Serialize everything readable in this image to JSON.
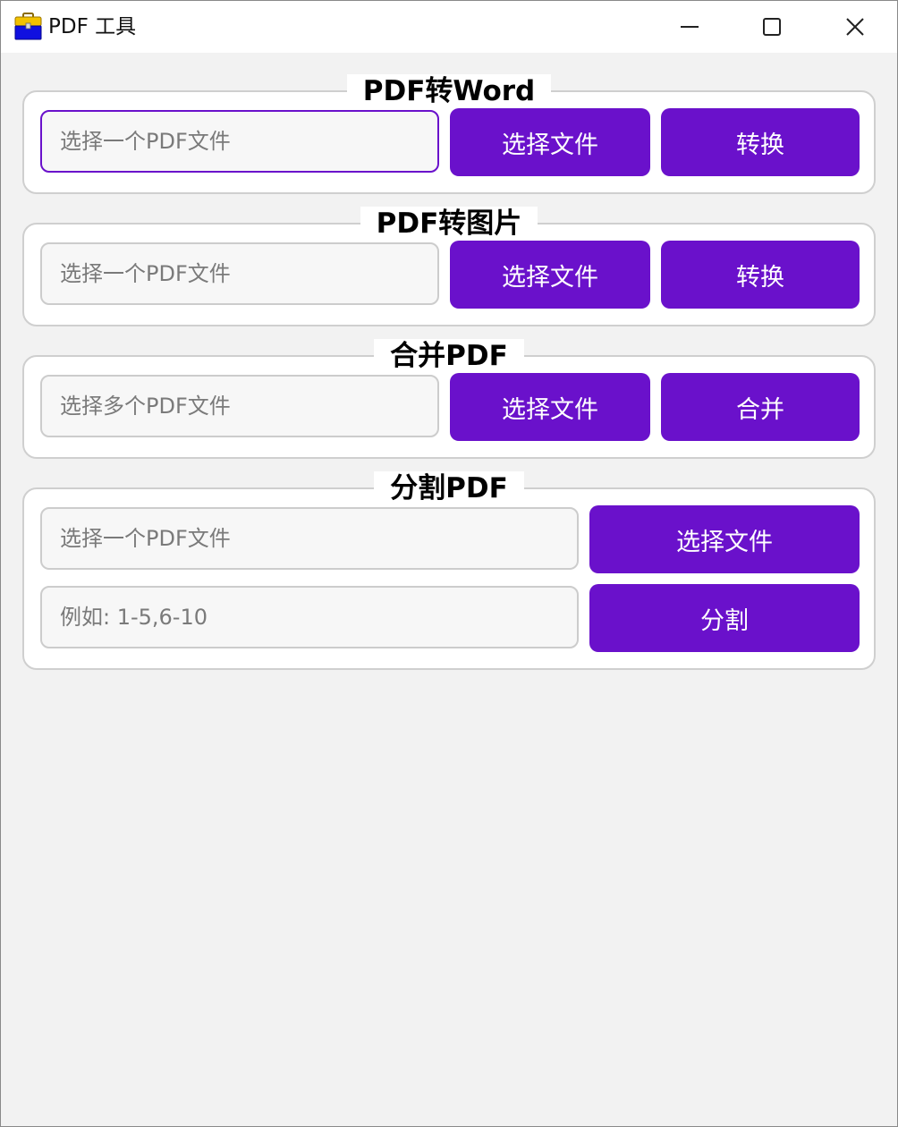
{
  "window": {
    "title": "PDF 工具",
    "icon": "toolbox-icon",
    "controls": {
      "minimize": "minimize-icon",
      "maximize": "maximize-icon",
      "close": "close-icon"
    }
  },
  "colors": {
    "accent": "#6a11cb",
    "window_bg": "#f2f2f2",
    "group_bg": "#ffffff",
    "border": "#cfcfcf",
    "placeholder": "#7a7a7a"
  },
  "pdf_to_word": {
    "title": "PDF转Word",
    "file_input": {
      "value": "",
      "placeholder": "选择一个PDF文件"
    },
    "select_label": "选择文件",
    "convert_label": "转换"
  },
  "pdf_to_image": {
    "title": "PDF转图片",
    "file_input": {
      "value": "",
      "placeholder": "选择一个PDF文件"
    },
    "select_label": "选择文件",
    "convert_label": "转换"
  },
  "merge_pdf": {
    "title": "合并PDF",
    "file_input": {
      "value": "",
      "placeholder": "选择多个PDF文件"
    },
    "select_label": "选择文件",
    "merge_label": "合并"
  },
  "split_pdf": {
    "title": "分割PDF",
    "file_input": {
      "value": "",
      "placeholder": "选择一个PDF文件"
    },
    "select_label": "选择文件",
    "range_input": {
      "value": "",
      "placeholder": "例如: 1-5,6-10"
    },
    "split_label": "分割"
  }
}
